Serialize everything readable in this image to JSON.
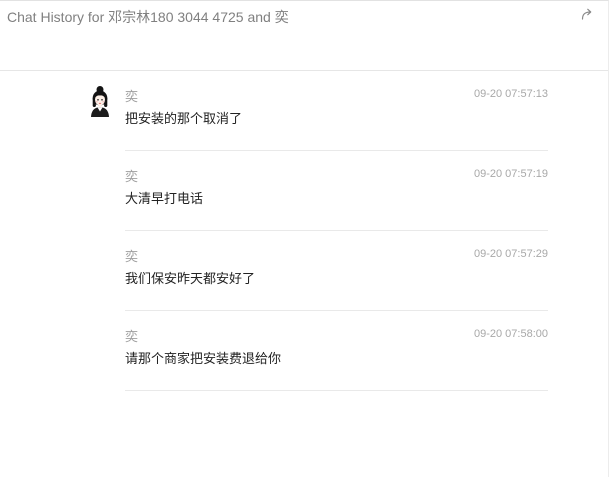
{
  "header": {
    "title": "Chat History for 邓宗林180 3044 4725 and 奕",
    "share_icon": "share-icon"
  },
  "messages": [
    {
      "sender": "奕",
      "time": "09-20 07:57:13",
      "text": "把安装的那个取消了",
      "avatar": "avatar"
    },
    {
      "sender": "奕",
      "time": "09-20 07:57:19",
      "text": "大清早打电话"
    },
    {
      "sender": "奕",
      "time": "09-20 07:57:29",
      "text": "我们保安昨天都安好了"
    },
    {
      "sender": "奕",
      "time": "09-20 07:58:00",
      "text": "请那个商家把安装费退给你"
    }
  ],
  "colors": {
    "message_text": "#222222",
    "muted_text": "#a0a0a0",
    "divider": "#e9e9e9"
  }
}
